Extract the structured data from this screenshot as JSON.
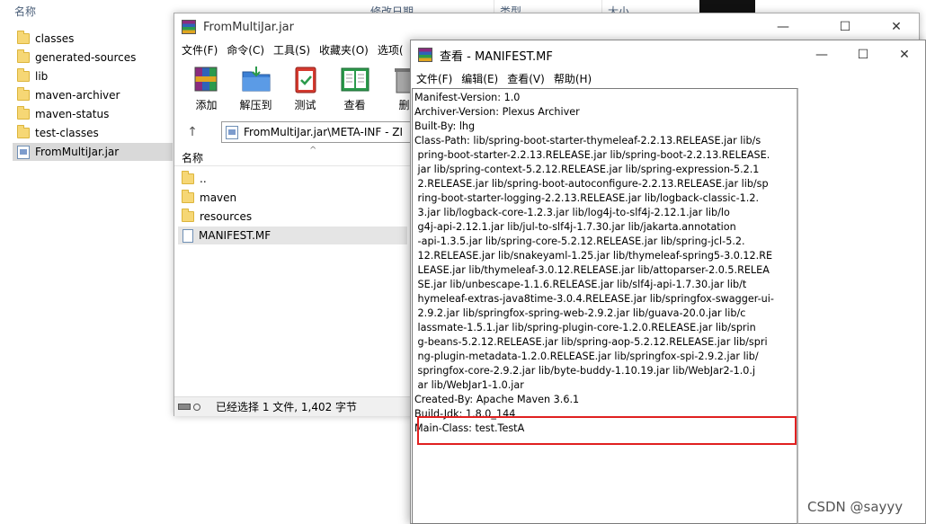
{
  "explorer": {
    "header": {
      "name": "名称",
      "modified": "修改日期",
      "type": "类型",
      "size": "大小"
    },
    "items": [
      {
        "label": "classes",
        "icon": "folder-icon"
      },
      {
        "label": "generated-sources",
        "icon": "folder-icon"
      },
      {
        "label": "lib",
        "icon": "folder-icon"
      },
      {
        "label": "maven-archiver",
        "icon": "folder-icon"
      },
      {
        "label": "maven-status",
        "icon": "folder-icon"
      },
      {
        "label": "test-classes",
        "icon": "folder-icon"
      },
      {
        "label": "FromMultiJar.jar",
        "icon": "jar-icon",
        "selected": true
      }
    ]
  },
  "winrar": {
    "title": "FromMultiJar.jar",
    "controls": {
      "minimize": "—",
      "maximize": "☐",
      "close": "✕"
    },
    "menu": [
      "文件(F)",
      "命令(C)",
      "工具(S)",
      "收藏夹(O)",
      "选项("
    ],
    "toolbar": [
      {
        "label": "添加",
        "icon": "add-archive-icon"
      },
      {
        "label": "解压到",
        "icon": "extract-folder-icon"
      },
      {
        "label": "测试",
        "icon": "test-clipboard-icon"
      },
      {
        "label": "查看",
        "icon": "view-book-icon"
      },
      {
        "label": "删",
        "icon": "delete-bin-icon"
      }
    ],
    "address": "FromMultiJar.jar\\META-INF - ZI",
    "up_arrow": "↑",
    "list_header": "名称",
    "sort_arrow": "^",
    "list": [
      {
        "label": "..",
        "icon": "folder-icon"
      },
      {
        "label": "maven",
        "icon": "folder-icon"
      },
      {
        "label": "resources",
        "icon": "folder-icon"
      },
      {
        "label": "MANIFEST.MF",
        "icon": "file-icon",
        "selected": true
      }
    ],
    "status": "已经选择 1 文件, 1,402 字节"
  },
  "viewer": {
    "title": "查看 - MANIFEST.MF",
    "controls": {
      "minimize": "—",
      "maximize": "☐",
      "close": "✕"
    },
    "menu": [
      "文件(F)",
      "编辑(E)",
      "查看(V)",
      "帮助(H)"
    ],
    "lines": [
      "Manifest-Version: 1.0",
      "Archiver-Version: Plexus Archiver",
      "Built-By: lhg",
      "Class-Path: lib/spring-boot-starter-thymeleaf-2.2.13.RELEASE.jar lib/s",
      " pring-boot-starter-2.2.13.RELEASE.jar lib/spring-boot-2.2.13.RELEASE.",
      " jar lib/spring-context-5.2.12.RELEASE.jar lib/spring-expression-5.2.1",
      " 2.RELEASE.jar lib/spring-boot-autoconfigure-2.2.13.RELEASE.jar lib/sp",
      " ring-boot-starter-logging-2.2.13.RELEASE.jar lib/logback-classic-1.2.",
      " 3.jar lib/logback-core-1.2.3.jar lib/log4j-to-slf4j-2.12.1.jar lib/lo",
      " g4j-api-2.12.1.jar lib/jul-to-slf4j-1.7.30.jar lib/jakarta.annotation",
      " -api-1.3.5.jar lib/spring-core-5.2.12.RELEASE.jar lib/spring-jcl-5.2.",
      " 12.RELEASE.jar lib/snakeyaml-1.25.jar lib/thymeleaf-spring5-3.0.12.RE",
      " LEASE.jar lib/thymeleaf-3.0.12.RELEASE.jar lib/attoparser-2.0.5.RELEA",
      " SE.jar lib/unbescape-1.1.6.RELEASE.jar lib/slf4j-api-1.7.30.jar lib/t",
      " hymeleaf-extras-java8time-3.0.4.RELEASE.jar lib/springfox-swagger-ui-",
      " 2.9.2.jar lib/springfox-spring-web-2.9.2.jar lib/guava-20.0.jar lib/c",
      " lassmate-1.5.1.jar lib/spring-plugin-core-1.2.0.RELEASE.jar lib/sprin",
      " g-beans-5.2.12.RELEASE.jar lib/spring-aop-5.2.12.RELEASE.jar lib/spri",
      " ng-plugin-metadata-1.2.0.RELEASE.jar lib/springfox-spi-2.9.2.jar lib/",
      " springfox-core-2.9.2.jar lib/byte-buddy-1.10.19.jar lib/WebJar2-1.0.j",
      " ar lib/WebJar1-1.0.jar",
      "Created-By: Apache Maven 3.6.1",
      "Build-Jdk: 1.8.0_144",
      "Main-Class: test.TestA"
    ]
  },
  "watermark": "CSDN @sayyy",
  "colors": {
    "highlight": "#e02020",
    "selection": "#d9d9d9"
  }
}
